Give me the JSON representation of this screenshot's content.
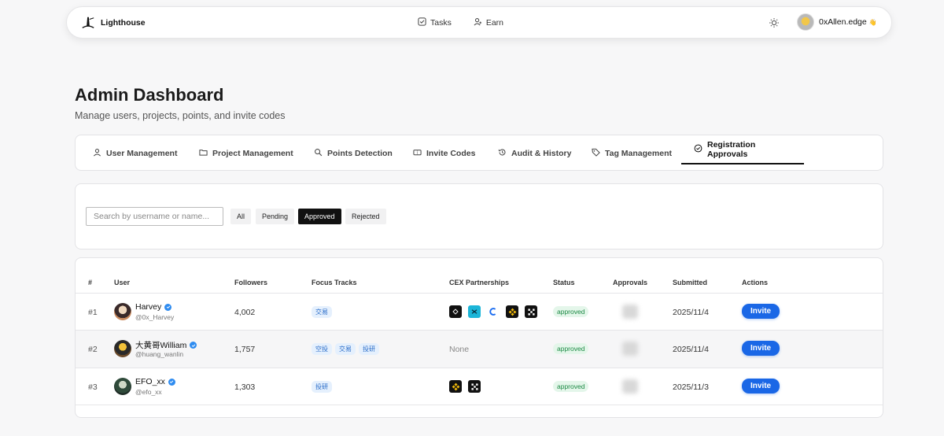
{
  "nav": {
    "brand": "Lighthouse",
    "links": [
      {
        "label": "Tasks",
        "icon": "checkbox-icon"
      },
      {
        "label": "Earn",
        "icon": "user-earn-icon"
      }
    ],
    "user_name": "0xAllen.edge",
    "user_suffix": "👋"
  },
  "header": {
    "title": "Admin Dashboard",
    "subtitle": "Manage users, projects, points, and invite codes"
  },
  "tabs": [
    {
      "label": "User Management",
      "icon": "users-icon"
    },
    {
      "label": "Project Management",
      "icon": "folder-icon"
    },
    {
      "label": "Points Detection",
      "icon": "search-points-icon"
    },
    {
      "label": "Invite Codes",
      "icon": "ticket-icon"
    },
    {
      "label": "Audit & History",
      "icon": "history-icon"
    },
    {
      "label": "Tag Management",
      "icon": "tag-icon"
    },
    {
      "label": "Registration Approvals",
      "icon": "check-circle-icon",
      "active": true
    }
  ],
  "filters": {
    "search_placeholder": "Search by username or name...",
    "options": [
      "All",
      "Pending",
      "Approved",
      "Rejected"
    ],
    "selected": "Approved"
  },
  "table": {
    "columns": [
      "#",
      "User",
      "Followers",
      "Focus Tracks",
      "CEX Partnerships",
      "Status",
      "Approvals",
      "Submitted",
      "Actions"
    ],
    "rows": [
      {
        "rank": "#1",
        "name": "Harvey",
        "handle": "@0x_Harvey",
        "followers": "4,002",
        "tracks": [
          "交易"
        ],
        "cex": [
          "bitget",
          "bybit",
          "coinbase",
          "binance",
          "okx"
        ],
        "cex_none": "",
        "status": "approved",
        "submitted": "2025/11/4",
        "action": "Invite"
      },
      {
        "rank": "#2",
        "name": "大黄哥William",
        "handle": "@huang_wanlin",
        "followers": "1,757",
        "tracks": [
          "空投",
          "交易",
          "投研"
        ],
        "cex": [],
        "cex_none": "None",
        "status": "approved",
        "submitted": "2025/11/4",
        "action": "Invite"
      },
      {
        "rank": "#3",
        "name": "EFO_xx",
        "handle": "@efo_xx",
        "followers": "1,303",
        "tracks": [
          "投研"
        ],
        "cex": [
          "binance",
          "okx"
        ],
        "cex_none": "",
        "status": "approved",
        "submitted": "2025/11/3",
        "action": "Invite"
      }
    ]
  },
  "colors": {
    "accent": "#1a67e6",
    "approved_text": "#1d8a45",
    "approved_bg": "#e4f6ea",
    "tag_text": "#2a6dc9",
    "tag_bg": "#e5f0fd"
  }
}
